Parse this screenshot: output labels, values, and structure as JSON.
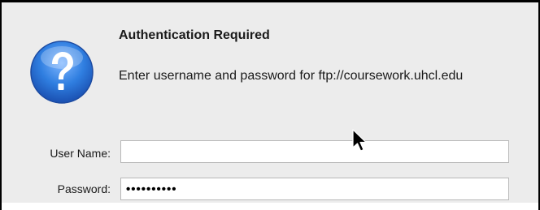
{
  "dialog": {
    "icon": "question-icon",
    "title": "Authentication Required",
    "message": "Enter username and password for ftp://coursework.uhcl.edu"
  },
  "form": {
    "username_label": "User Name:",
    "username_value": "",
    "password_label": "Password:",
    "password_value": "••••••••••"
  },
  "colors": {
    "dialog_background": "#ececec",
    "icon_blue": "#2f7ee0"
  }
}
